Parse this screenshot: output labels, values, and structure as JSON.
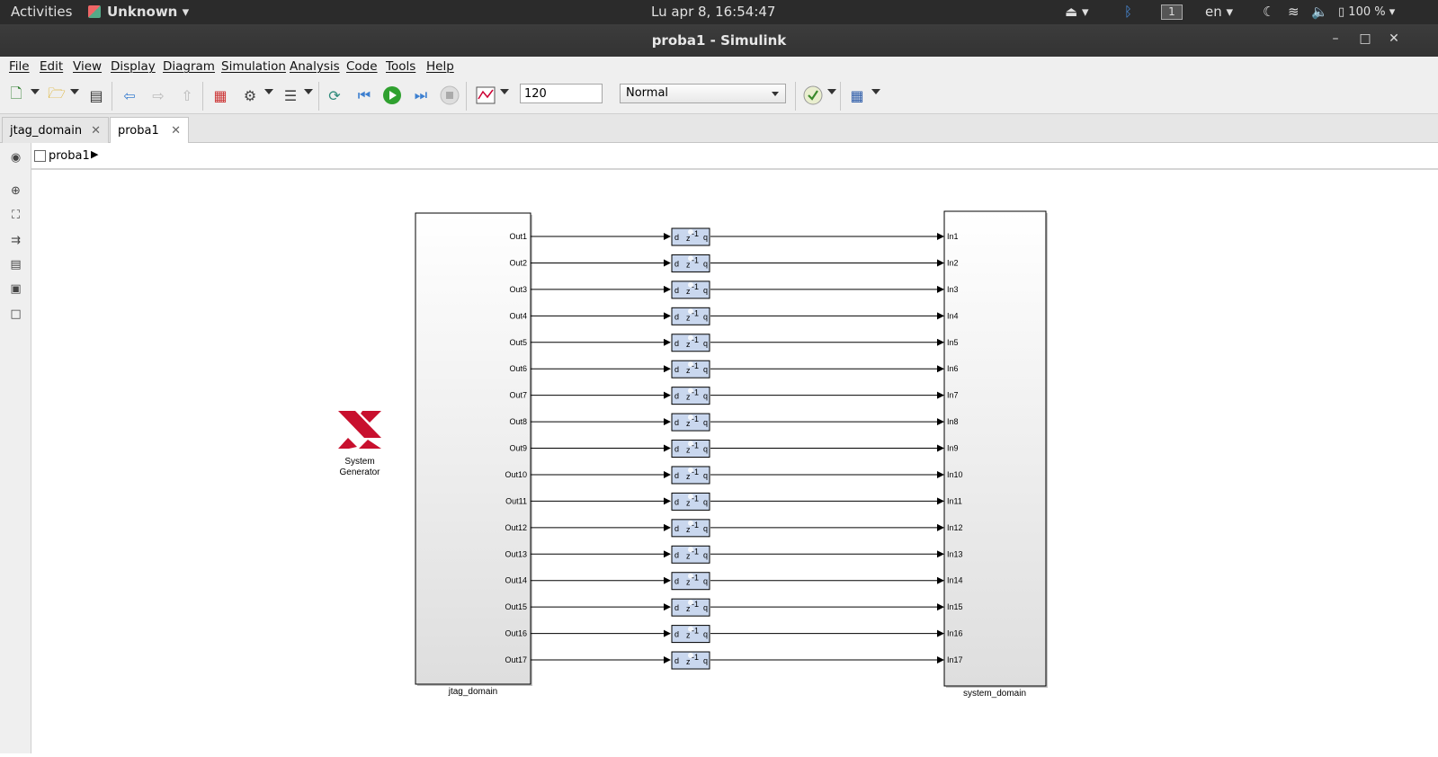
{
  "topbar": {
    "activities": "Activities",
    "app_name": "Unknown",
    "clock": "Lu apr  8, 16:54:47",
    "workspace": "1",
    "language": "en",
    "battery": "100 %"
  },
  "window": {
    "title": "proba1 - Simulink"
  },
  "menu": [
    "File",
    "Edit",
    "View",
    "Display",
    "Diagram",
    "Simulation",
    "Analysis",
    "Code",
    "Tools",
    "Help"
  ],
  "toolbar": {
    "stop_time": "120",
    "sim_mode": "Normal"
  },
  "tabs": [
    {
      "label": "jtag_domain"
    },
    {
      "label": "proba1"
    }
  ],
  "breadcrumb": {
    "model": "proba1"
  },
  "diagram": {
    "logo_line1": "System",
    "logo_line2": "Generator",
    "left_block": "jtag_domain",
    "right_block": "system_domain",
    "delay": {
      "in": "d",
      "op": "z",
      "exp": "-1",
      "out": "q"
    },
    "outputs": [
      "Out1",
      "Out2",
      "Out3",
      "Out4",
      "Out5",
      "Out6",
      "Out7",
      "Out8",
      "Out9",
      "Out10",
      "Out11",
      "Out12",
      "Out13",
      "Out14",
      "Out15",
      "Out16",
      "Out17"
    ],
    "inputs": [
      "In1",
      "In2",
      "In3",
      "In4",
      "In5",
      "In6",
      "In7",
      "In8",
      "In9",
      "In10",
      "In11",
      "In12",
      "In13",
      "In14",
      "In15",
      "In16",
      "In17"
    ],
    "colors": {
      "logo_red": "#c8102e",
      "delay_fill": "#c9d7ee"
    }
  }
}
